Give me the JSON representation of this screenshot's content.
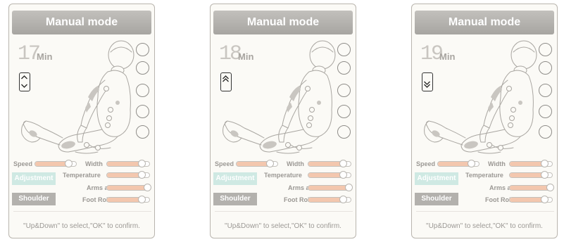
{
  "screens": [
    {
      "title": "Manual mode",
      "timer_value": "17",
      "timer_unit": "Min",
      "arrow_state": "up-down",
      "sliders": {
        "speed": {
          "label": "Speed",
          "value": 0.8
        },
        "width": {
          "label": "Width",
          "value": 0.8
        },
        "temperature": {
          "label": "Temperature",
          "value": 0.8
        },
        "arms_air": {
          "label": "Arms air",
          "value": 1.0
        },
        "foot_roll": {
          "label": "Foot Roll",
          "value": 0.8
        }
      },
      "buttons": {
        "adjustment": "Adjustment",
        "shoulder": "Shoulder"
      },
      "hint": "\"Up&Down\" to select,\"OK\" to confirm."
    },
    {
      "title": "Manual mode",
      "timer_value": "18",
      "timer_unit": "Min",
      "arrow_state": "up",
      "sliders": {
        "speed": {
          "label": "Speed",
          "value": 0.8
        },
        "width": {
          "label": "Width",
          "value": 0.8
        },
        "temperature": {
          "label": "Temperature",
          "value": 0.8
        },
        "arms_air": {
          "label": "Arms air",
          "value": 1.0
        },
        "foot_roll": {
          "label": "Foot Roll",
          "value": 0.8
        }
      },
      "buttons": {
        "adjustment": "Adjustment",
        "shoulder": "Shoulder"
      },
      "hint": "\"Up&Down\" to select,\"OK\" to confirm."
    },
    {
      "title": "Manual mode",
      "timer_value": "19",
      "timer_unit": "Min",
      "arrow_state": "down",
      "sliders": {
        "speed": {
          "label": "Speed",
          "value": 0.8
        },
        "width": {
          "label": "Width",
          "value": 0.8
        },
        "temperature": {
          "label": "Temperature",
          "value": 0.8
        },
        "arms_air": {
          "label": "Arms air",
          "value": 1.0
        },
        "foot_roll": {
          "label": "Foot Roll",
          "value": 0.8
        }
      },
      "buttons": {
        "adjustment": "Adjustment",
        "shoulder": "Shoulder"
      },
      "hint": "\"Up&Down\" to select,\"OK\" to confirm."
    }
  ],
  "colors": {
    "slider_fill": "#f3c7ae",
    "adjustment_button": "#cfe9e3",
    "shoulder_button": "#b3b1ad",
    "title_bar": "#b5b3af",
    "massage_zone": "#c9c6c1"
  }
}
